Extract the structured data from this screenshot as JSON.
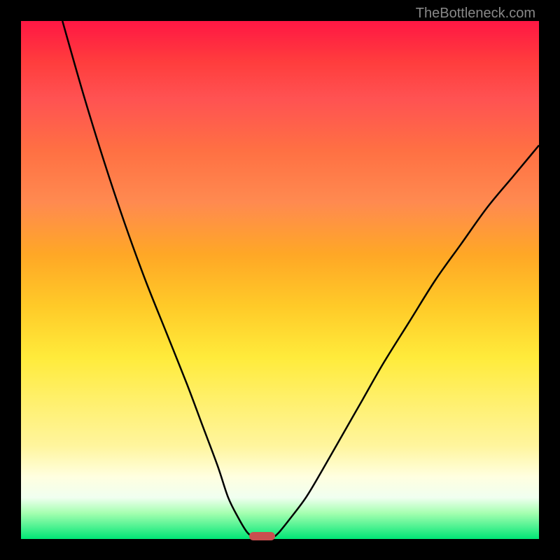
{
  "watermark": "TheBottleneck.com",
  "chart_data": {
    "type": "line",
    "title": "",
    "xlabel": "",
    "ylabel": "",
    "xlim": [
      0,
      100
    ],
    "ylim": [
      0,
      100
    ],
    "series": [
      {
        "name": "left-curve",
        "x": [
          8,
          12,
          16,
          20,
          24,
          28,
          32,
          35,
          38,
          40,
          42,
          43.5,
          44.5
        ],
        "y": [
          100,
          86,
          73,
          61,
          50,
          40,
          30,
          22,
          14,
          8,
          4,
          1.5,
          0.5
        ]
      },
      {
        "name": "right-curve",
        "x": [
          49,
          50,
          52,
          55,
          58,
          62,
          66,
          70,
          75,
          80,
          85,
          90,
          95,
          100
        ],
        "y": [
          0.5,
          1.5,
          4,
          8,
          13,
          20,
          27,
          34,
          42,
          50,
          57,
          64,
          70,
          76
        ]
      }
    ],
    "marker": {
      "x_start": 44,
      "x_end": 49,
      "y": 0.5,
      "color": "#c94f4f"
    },
    "background_gradient": {
      "top": "#ff1744",
      "bottom": "#00e676"
    }
  }
}
